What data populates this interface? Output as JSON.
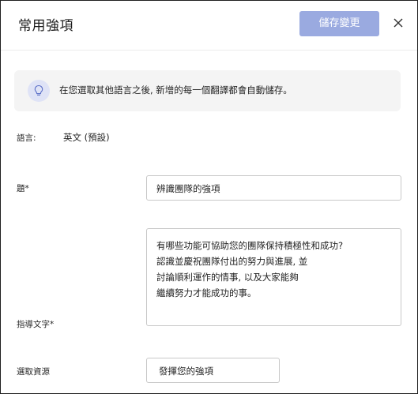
{
  "header": {
    "title": "常用強項",
    "save_label": "儲存變更"
  },
  "notice": {
    "text": "在您選取其他語言之後, 新增的每一個翻譯都會自動儲存。"
  },
  "form": {
    "language_label": "語言:",
    "language_value": "英文 (預設)",
    "title_label": "題*",
    "title_value": "辨識團隊的強項",
    "guidance_label": "指導文字*",
    "guidance_lines": [
      "有哪些功能可協助您的團隊保持積極性和成功?",
      "認識並慶祝團隊付出的努力與進展, 並",
      "討論順利運作的情事, 以及大家能夠",
      "繼續努力才能成功的事。"
    ],
    "resource_label": "選取資源",
    "resource_value": "發揮您的強項"
  }
}
